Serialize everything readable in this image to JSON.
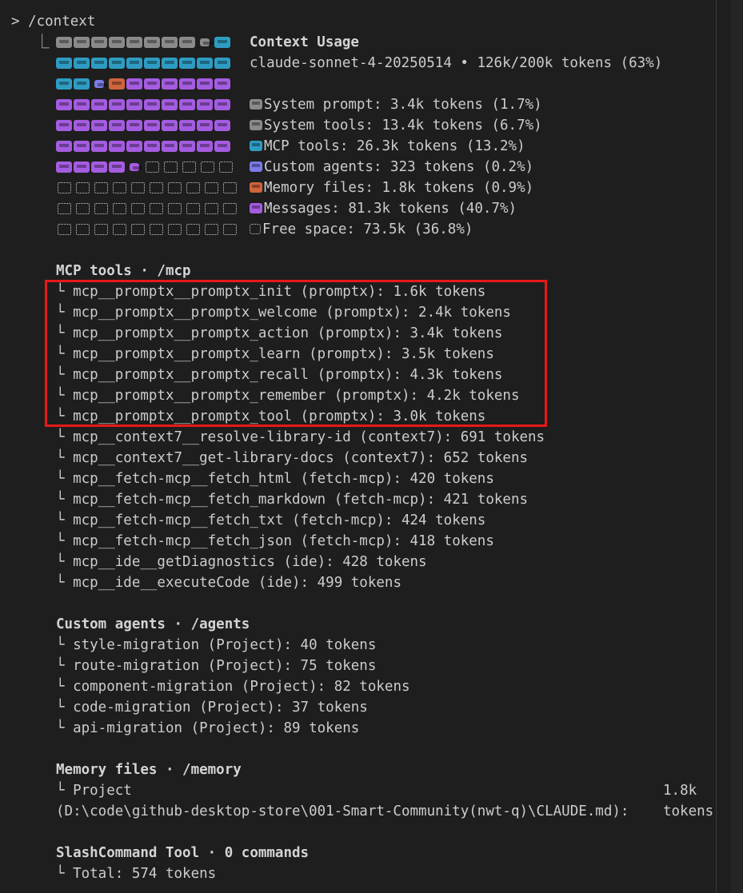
{
  "command": "> /context",
  "header": {
    "title": "Context Usage",
    "model_line": "claude-sonnet-4-20250514 • 126k/200k tokens (63%)"
  },
  "colors": {
    "system": "#8a8a8a",
    "mcp": "#2e9cc2",
    "agents": "#7b7be8",
    "memory": "#d0643c",
    "messages": "#a45ce0",
    "free": "#cfcfcf"
  },
  "grid": [
    [
      "system",
      "system",
      "system",
      "system",
      "system",
      "system",
      "system",
      "system",
      "system-half",
      "mcp"
    ],
    [
      "mcp",
      "mcp",
      "mcp",
      "mcp",
      "mcp",
      "mcp",
      "mcp",
      "mcp",
      "mcp",
      "mcp"
    ],
    [
      "mcp",
      "mcp",
      "agents-half",
      "memory",
      "messages",
      "messages",
      "messages",
      "messages",
      "messages",
      "messages"
    ],
    [
      "messages",
      "messages",
      "messages",
      "messages",
      "messages",
      "messages",
      "messages",
      "messages",
      "messages",
      "messages"
    ],
    [
      "messages",
      "messages",
      "messages",
      "messages",
      "messages",
      "messages",
      "messages",
      "messages",
      "messages",
      "messages"
    ],
    [
      "messages",
      "messages",
      "messages",
      "messages",
      "messages",
      "messages",
      "messages",
      "messages",
      "messages",
      "messages"
    ],
    [
      "messages",
      "messages",
      "messages",
      "messages",
      "messages-half",
      "free",
      "free",
      "free",
      "free",
      "free"
    ],
    [
      "free",
      "free",
      "free",
      "free",
      "free",
      "free",
      "free",
      "free",
      "free",
      "free"
    ],
    [
      "free",
      "free",
      "free",
      "free",
      "free",
      "free",
      "free",
      "free",
      "free",
      "free"
    ],
    [
      "free",
      "free",
      "free",
      "free",
      "free",
      "free",
      "free",
      "free",
      "free",
      "free"
    ]
  ],
  "legend": [
    {
      "icon": "system",
      "text": "System prompt: 3.4k tokens (1.7%)"
    },
    {
      "icon": "system",
      "text": "System tools: 13.4k tokens (6.7%)"
    },
    {
      "icon": "mcp",
      "text": "MCP tools: 26.3k tokens (13.2%)"
    },
    {
      "icon": "agents",
      "text": "Custom agents: 323 tokens (0.2%)"
    },
    {
      "icon": "memory",
      "text": "Memory files: 1.8k tokens (0.9%)"
    },
    {
      "icon": "messages",
      "text": "Messages: 81.3k tokens (40.7%)"
    },
    {
      "icon": "free",
      "text": "Free space: 73.5k (36.8%)"
    }
  ],
  "mcp": {
    "heading": "MCP tools · /mcp",
    "items": [
      "mcp__promptx__promptx_init (promptx): 1.6k tokens",
      "mcp__promptx__promptx_welcome (promptx): 2.4k tokens",
      "mcp__promptx__promptx_action (promptx): 3.4k tokens",
      "mcp__promptx__promptx_learn (promptx): 3.5k tokens",
      "mcp__promptx__promptx_recall (promptx): 4.3k tokens",
      "mcp__promptx__promptx_remember (promptx): 4.2k tokens",
      "mcp__promptx__promptx_tool (promptx): 3.0k tokens",
      "mcp__context7__resolve-library-id (context7): 691 tokens",
      "mcp__context7__get-library-docs (context7): 652 tokens",
      "mcp__fetch-mcp__fetch_html (fetch-mcp): 420 tokens",
      "mcp__fetch-mcp__fetch_markdown (fetch-mcp): 421 tokens",
      "mcp__fetch-mcp__fetch_txt (fetch-mcp): 424 tokens",
      "mcp__fetch-mcp__fetch_json (fetch-mcp): 418 tokens",
      "mcp__ide__getDiagnostics (ide): 428 tokens",
      "mcp__ide__executeCode (ide): 499 tokens"
    ]
  },
  "agents": {
    "heading": "Custom agents · /agents",
    "items": [
      "style-migration (Project): 40 tokens",
      "route-migration (Project): 75 tokens",
      "component-migration (Project): 82 tokens",
      "code-migration (Project): 37 tokens",
      "api-migration (Project): 89 tokens"
    ]
  },
  "memory": {
    "heading": "Memory files · /memory",
    "item_label": "Project",
    "item_size": "1.8k",
    "item_path": "(D:\\code\\github-desktop-store\\001-Smart-Community(nwt-q)\\CLAUDE.md):",
    "item_unit": "tokens"
  },
  "slash": {
    "heading": "SlashCommand Tool · 0 commands",
    "total": "Total: 574 tokens"
  },
  "tree_branch": "└ ",
  "tree_root": "⎿"
}
